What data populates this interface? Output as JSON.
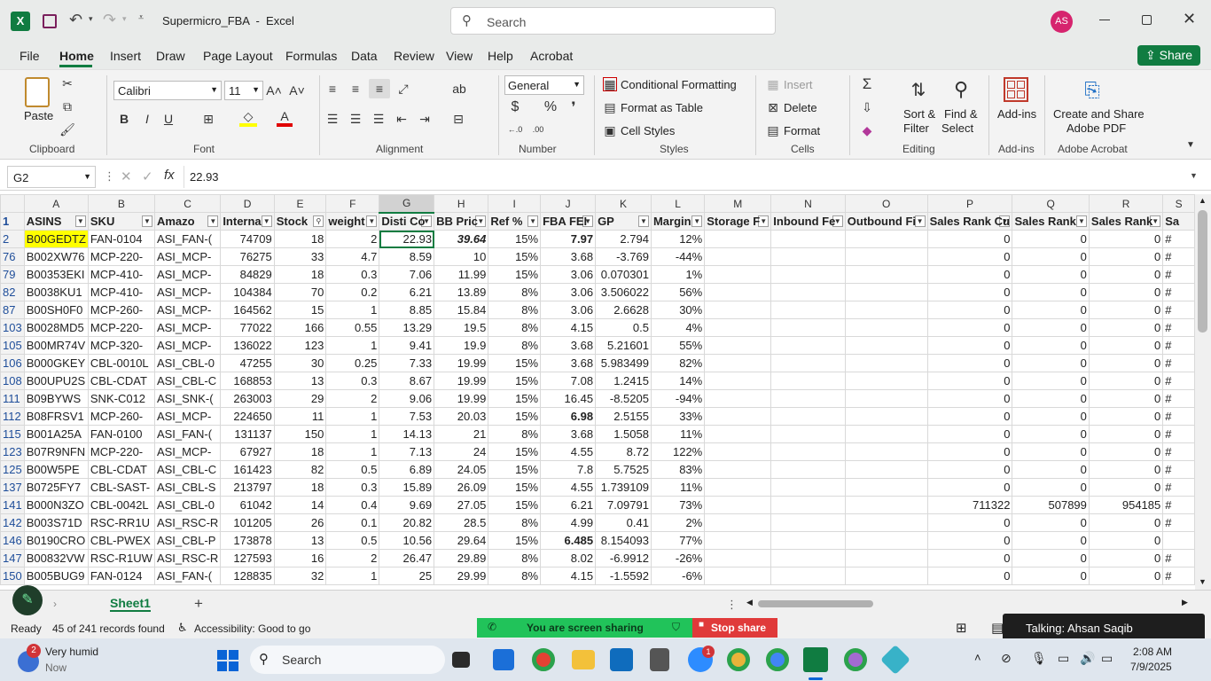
{
  "window": {
    "title": "Supermicro_FBA  -  Excel",
    "search_placeholder": "Search",
    "avatar": "AS"
  },
  "menu": {
    "tabs": [
      "File",
      "Home",
      "Insert",
      "Draw",
      "Page Layout",
      "Formulas",
      "Data",
      "Review",
      "View",
      "Help",
      "Acrobat"
    ],
    "share": "Share"
  },
  "ribbon": {
    "paste": "Paste",
    "clipboard": "Clipboard",
    "font_name": "Calibri",
    "font_size": "11",
    "font": "Font",
    "alignment": "Alignment",
    "number_format": "General",
    "number": "Number",
    "cond_format": "Conditional Formatting",
    "format_table": "Format as Table",
    "cell_styles": "Cell Styles",
    "styles": "Styles",
    "insert": "Insert",
    "delete": "Delete",
    "format": "Format",
    "cells": "Cells",
    "sort_filter": "Sort &",
    "sort_filter2": "Filter",
    "find_select": "Find &",
    "find_select2": "Select",
    "editing": "Editing",
    "addins": "Add-ins",
    "addins_group": "Add-ins",
    "create_pdf": "Create and Share",
    "create_pdf2": "Adobe PDF",
    "acrobat_group": "Adobe Acrobat"
  },
  "formula": {
    "name_box": "G2",
    "value": "22.93"
  },
  "grid": {
    "columns": [
      "A",
      "B",
      "C",
      "D",
      "E",
      "F",
      "G",
      "H",
      "I",
      "J",
      "K",
      "L",
      "M",
      "N",
      "O",
      "P",
      "Q",
      "R",
      "S"
    ],
    "headers": [
      "ASINS",
      "SKU",
      "Amazo",
      "Interna",
      "Stock",
      "weight",
      "Disti Co",
      "BB Pric",
      "Ref %",
      "FBA FEI",
      "GP",
      "Margin",
      "Storage F",
      "Inbound Fe",
      "Outbound Fi",
      "Sales Rank Cu",
      "Sales Rank",
      "Sales Rank",
      "Sa"
    ],
    "rows": [
      {
        "n": "2",
        "c": [
          "B00GEDTZ",
          "FAN-0104",
          "ASI_FAN-(",
          "74709",
          "18",
          "2",
          "22.93",
          "39.64",
          "15%",
          "7.97",
          "2.794",
          "12%",
          "",
          "",
          "",
          "0",
          "0",
          "0",
          "#"
        ]
      },
      {
        "n": "76",
        "c": [
          "B002XW76",
          "MCP-220-",
          "ASI_MCP-",
          "76275",
          "33",
          "4.7",
          "8.59",
          "10",
          "15%",
          "3.68",
          "-3.769",
          "-44%",
          "",
          "",
          "",
          "0",
          "0",
          "0",
          "#"
        ]
      },
      {
        "n": "79",
        "c": [
          "B00353EKI",
          "MCP-410-",
          "ASI_MCP-",
          "84829",
          "18",
          "0.3",
          "7.06",
          "11.99",
          "15%",
          "3.06",
          "0.070301",
          "1%",
          "",
          "",
          "",
          "0",
          "0",
          "0",
          "#"
        ]
      },
      {
        "n": "82",
        "c": [
          "B0038KU1",
          "MCP-410-",
          "ASI_MCP-",
          "104384",
          "70",
          "0.2",
          "6.21",
          "13.89",
          "8%",
          "3.06",
          "3.506022",
          "56%",
          "",
          "",
          "",
          "0",
          "0",
          "0",
          "#"
        ]
      },
      {
        "n": "87",
        "c": [
          "B00SH0F0",
          "MCP-260-",
          "ASI_MCP-",
          "164562",
          "15",
          "1",
          "8.85",
          "15.84",
          "8%",
          "3.06",
          "2.6628",
          "30%",
          "",
          "",
          "",
          "0",
          "0",
          "0",
          "#"
        ]
      },
      {
        "n": "103",
        "c": [
          "B0028MD5",
          "MCP-220-",
          "ASI_MCP-",
          "77022",
          "166",
          "0.55",
          "13.29",
          "19.5",
          "8%",
          "4.15",
          "0.5",
          "4%",
          "",
          "",
          "",
          "0",
          "0",
          "0",
          "#"
        ]
      },
      {
        "n": "105",
        "c": [
          "B00MR74V",
          "MCP-320-",
          "ASI_MCP-",
          "136022",
          "123",
          "1",
          "9.41",
          "19.9",
          "8%",
          "3.68",
          "5.21601",
          "55%",
          "",
          "",
          "",
          "0",
          "0",
          "0",
          "#"
        ]
      },
      {
        "n": "106",
        "c": [
          "B000GKEY",
          "CBL-0010L",
          "ASI_CBL-0",
          "47255",
          "30",
          "0.25",
          "7.33",
          "19.99",
          "15%",
          "3.68",
          "5.983499",
          "82%",
          "",
          "",
          "",
          "0",
          "0",
          "0",
          "#"
        ]
      },
      {
        "n": "108",
        "c": [
          "B00UPU2S",
          "CBL-CDAT",
          "ASI_CBL-C",
          "168853",
          "13",
          "0.3",
          "8.67",
          "19.99",
          "15%",
          "7.08",
          "1.2415",
          "14%",
          "",
          "",
          "",
          "0",
          "0",
          "0",
          "#"
        ]
      },
      {
        "n": "111",
        "c": [
          "B09BYWS",
          "SNK-C012",
          "ASI_SNK-(",
          "263003",
          "29",
          "2",
          "9.06",
          "19.99",
          "15%",
          "16.45",
          "-8.5205",
          "-94%",
          "",
          "",
          "",
          "0",
          "0",
          "0",
          "#"
        ]
      },
      {
        "n": "112",
        "c": [
          "B08FRSV1",
          "MCP-260-",
          "ASI_MCP-",
          "224650",
          "11",
          "1",
          "7.53",
          "20.03",
          "15%",
          "6.98",
          "2.5155",
          "33%",
          "",
          "",
          "",
          "0",
          "0",
          "0",
          "#"
        ]
      },
      {
        "n": "115",
        "c": [
          "B001A25A",
          "FAN-0100",
          "ASI_FAN-(",
          "131137",
          "150",
          "1",
          "14.13",
          "21",
          "8%",
          "3.68",
          "1.5058",
          "11%",
          "",
          "",
          "",
          "0",
          "0",
          "0",
          "#"
        ]
      },
      {
        "n": "123",
        "c": [
          "B07R9NFN",
          "MCP-220-",
          "ASI_MCP-",
          "67927",
          "18",
          "1",
          "7.13",
          "24",
          "15%",
          "4.55",
          "8.72",
          "122%",
          "",
          "",
          "",
          "0",
          "0",
          "0",
          "#"
        ]
      },
      {
        "n": "125",
        "c": [
          "B00W5PE",
          "CBL-CDAT",
          "ASI_CBL-C",
          "161423",
          "82",
          "0.5",
          "6.89",
          "24.05",
          "15%",
          "7.8",
          "5.7525",
          "83%",
          "",
          "",
          "",
          "0",
          "0",
          "0",
          "#"
        ]
      },
      {
        "n": "137",
        "c": [
          "B0725FY7",
          "CBL-SAST-",
          "ASI_CBL-S",
          "213797",
          "18",
          "0.3",
          "15.89",
          "26.09",
          "15%",
          "4.55",
          "1.739109",
          "11%",
          "",
          "",
          "",
          "0",
          "0",
          "0",
          "#"
        ]
      },
      {
        "n": "141",
        "c": [
          "B000N3ZO",
          "CBL-0042L",
          "ASI_CBL-0",
          "61042",
          "14",
          "0.4",
          "9.69",
          "27.05",
          "15%",
          "6.21",
          "7.09791",
          "73%",
          "",
          "",
          "",
          "711322",
          "507899",
          "954185",
          "#"
        ]
      },
      {
        "n": "142",
        "c": [
          "B003S71D",
          "RSC-RR1U",
          "ASI_RSC-R",
          "101205",
          "26",
          "0.1",
          "20.82",
          "28.5",
          "8%",
          "4.99",
          "0.41",
          "2%",
          "",
          "",
          "",
          "0",
          "0",
          "0",
          "#"
        ]
      },
      {
        "n": "146",
        "c": [
          "B0190CRO",
          "CBL-PWEX",
          "ASI_CBL-P",
          "173878",
          "13",
          "0.5",
          "10.56",
          "29.64",
          "15%",
          "6.485",
          "8.154093",
          "77%",
          "",
          "",
          "",
          "0",
          "0",
          "0",
          ""
        ]
      },
      {
        "n": "147",
        "c": [
          "B00832VW",
          "RSC-R1UW",
          "ASI_RSC-R",
          "127593",
          "16",
          "2",
          "26.47",
          "29.89",
          "8%",
          "8.02",
          "-6.9912",
          "-26%",
          "",
          "",
          "",
          "0",
          "0",
          "0",
          "#"
        ]
      },
      {
        "n": "150",
        "c": [
          "B005BUG9",
          "FAN-0124",
          "ASI_FAN-(",
          "128835",
          "32",
          "1",
          "25",
          "29.99",
          "8%",
          "4.15",
          "-1.5592",
          "-6%",
          "",
          "",
          "",
          "0",
          "0",
          "0",
          "#"
        ]
      }
    ]
  },
  "sheet": {
    "tab": "Sheet1",
    "add": "+"
  },
  "status": {
    "ready": "Ready",
    "records": "45 of 241 records found",
    "accessibility": "Accessibility: Good to go",
    "sharing": "You are screen sharing",
    "stop": "Stop share",
    "talking": "Talking: Ahsan Saqib"
  },
  "taskbar": {
    "weather_badge": "2",
    "weather": "Very humid",
    "weather_sub": "Now",
    "search": "Search",
    "time": "2:08 AM",
    "date": "7/9/2025",
    "zoom_badge": "1"
  }
}
